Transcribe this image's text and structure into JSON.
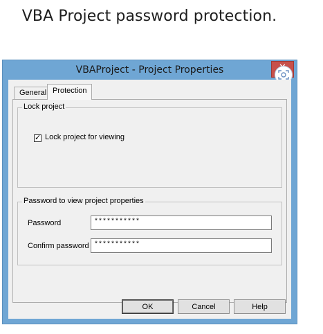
{
  "caption": "VBA Project password protection.",
  "window": {
    "title": "VBAProject - Project Properties",
    "close_glyph": "✕"
  },
  "tabs": [
    {
      "label": "General",
      "active": false
    },
    {
      "label": "Protection",
      "active": true
    }
  ],
  "lock_group": {
    "title": "Lock project",
    "checkbox_label": "Lock project for viewing",
    "checked": true
  },
  "password_group": {
    "title": "Password to view project properties",
    "password_label": "Password",
    "password_value": "***********",
    "confirm_label": "Confirm password",
    "confirm_value": "***********"
  },
  "buttons": {
    "ok": "OK",
    "cancel": "Cancel",
    "help": "Help"
  },
  "colors": {
    "frame": "#6fa6d4",
    "close": "#c7504a",
    "dialog_bg": "#f0f0f0"
  },
  "icons": {
    "close": "close-icon",
    "overlay_badge": "screen-capture-icon",
    "checkbox": "checkmark-icon"
  }
}
